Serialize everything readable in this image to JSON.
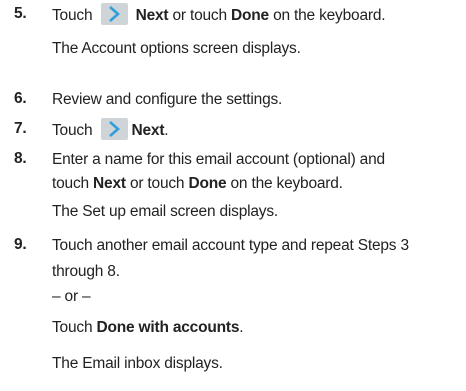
{
  "step5": {
    "number": "5.",
    "touch": "Touch",
    "next": "Next",
    "or_touch": "or touch",
    "done": "Done",
    "on_keyboard": "on the keyboard.",
    "result": "The Account options screen displays."
  },
  "step6": {
    "number": "6.",
    "text": "Review and configure the settings."
  },
  "step7": {
    "number": "7.",
    "touch": "Touch",
    "next": "Next",
    "period": "."
  },
  "step8": {
    "number": "8.",
    "line1": "Enter a name for this email account (optional) and",
    "touch": "touch",
    "next": "Next",
    "or_touch": "or touch",
    "done": "Done",
    "on_keyboard": "on the keyboard.",
    "result": "The Set up email screen displays."
  },
  "step9": {
    "number": "9.",
    "line1": "Touch another email account type and repeat Steps 3",
    "line2": "through 8.",
    "or": "– or –",
    "touch": "Touch",
    "done_with_accounts": "Done with accounts",
    "period": ".",
    "result": "The Email inbox displays."
  },
  "icons": {
    "next": "chevron-right-icon",
    "next_bg": "#cfd4d8",
    "next_arrow": "#2f9fdc"
  }
}
